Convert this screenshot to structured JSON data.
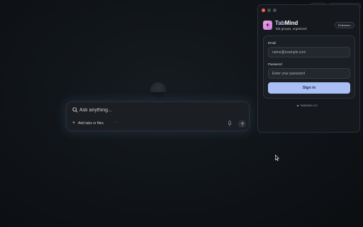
{
  "background_top": {
    "pills": [
      "",
      ""
    ]
  },
  "assistant": {
    "placeholder": "Ask anything...",
    "add_label": "Add tabs or files",
    "more_label": "···"
  },
  "extension": {
    "brand_part1": "Tab",
    "brand_part2": "Mind",
    "tagline": "Tab groups, organised",
    "badge": "Extension",
    "email_label": "Email",
    "email_placeholder": "name@example.com",
    "password_label": "Password",
    "password_placeholder": "Enter your password",
    "signin_label": "Sign in",
    "footer_domain": "TABMIND.CO"
  },
  "colors": {
    "accent": "#a9bff5",
    "brand_gradient_start": "#f0a5e0",
    "close_red": "#ff5f57"
  },
  "icons": [
    "search-icon",
    "plus-icon",
    "microphone-icon",
    "arrow-up-icon",
    "pointer-cursor-icon"
  ]
}
